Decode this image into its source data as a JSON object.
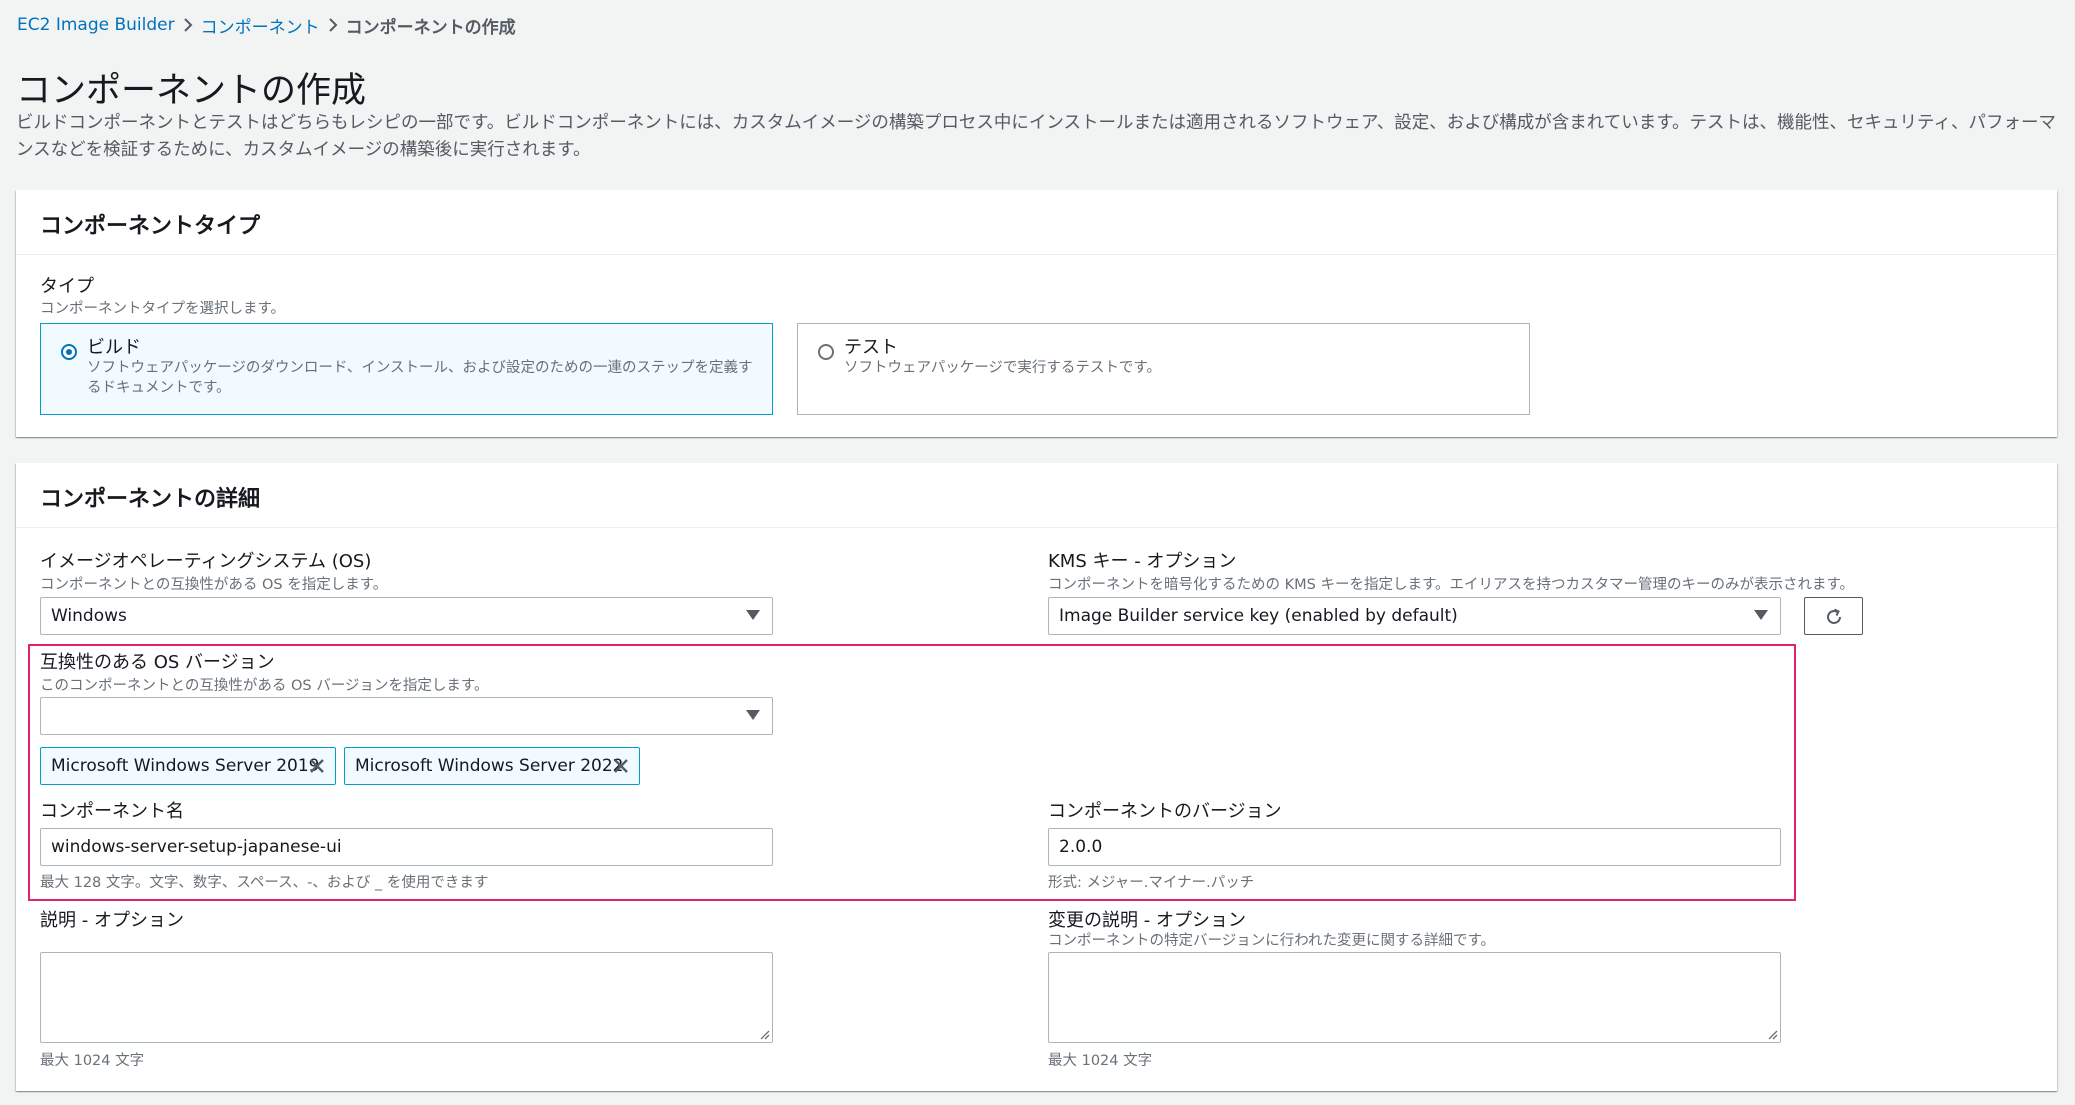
{
  "breadcrumb": {
    "items": [
      "EC2 Image Builder",
      "コンポーネント"
    ],
    "current": "コンポーネントの作成"
  },
  "page": {
    "title": "コンポーネントの作成",
    "description": "ビルドコンポーネントとテストはどちらもレシピの一部です。ビルドコンポーネントには、カスタムイメージの構築プロセス中にインストールまたは適用されるソフトウェア、設定、および構成が含まれています。テストは、機能性、セキュリティ、パフォーマンスなどを検証するために、カスタムイメージの構築後に実行されます。"
  },
  "type_panel": {
    "title": "コンポーネントタイプ",
    "label": "タイプ",
    "hint": "コンポーネントタイプを選択します。",
    "options": [
      {
        "title": "ビルド",
        "desc": "ソフトウェアパッケージのダウンロード、インストール、および設定のための一連のステップを定義するドキュメントです。",
        "selected": true
      },
      {
        "title": "テスト",
        "desc": "ソフトウェアパッケージで実行するテストです。",
        "selected": false
      }
    ]
  },
  "details": {
    "title": "コンポーネントの詳細",
    "os": {
      "label": "イメージオペレーティングシステム (OS)",
      "hint": "コンポーネントとの互換性がある OS を指定します。",
      "value": "Windows"
    },
    "kms": {
      "label": "KMS キー - オプション",
      "hint": "コンポーネントを暗号化するための KMS キーを指定します。エイリアスを持つカスタマー管理のキーのみが表示されます。",
      "value": "Image Builder service key (enabled by default)"
    },
    "os_versions": {
      "label": "互換性のある OS バージョン",
      "hint": "このコンポーネントとの互換性がある OS バージョンを指定します。",
      "value": "",
      "tokens": [
        "Microsoft Windows Server 2019",
        "Microsoft Windows Server 2022"
      ]
    },
    "name": {
      "label": "コンポーネント名",
      "value": "windows-server-setup-japanese-ui",
      "hint": "最大 128 文字。文字、数字、スペース、-、および _ を使用できます"
    },
    "version": {
      "label": "コンポーネントのバージョン",
      "value": "2.0.0",
      "hint": "形式: メジャー.マイナー.パッチ"
    },
    "description": {
      "label": "説明 - オプション",
      "value": "",
      "hint": "最大 1024 文字"
    },
    "change_description": {
      "label": "変更の説明 - オプション",
      "subhint": "コンポーネントの特定バージョンに行われた変更に関する詳細です。",
      "value": "",
      "hint": "最大 1024 文字"
    }
  },
  "colors": {
    "link": "#0073bb",
    "highlight": "#e0226f",
    "selected_border": "#00a1c9",
    "selected_bg": "#f1faff"
  }
}
